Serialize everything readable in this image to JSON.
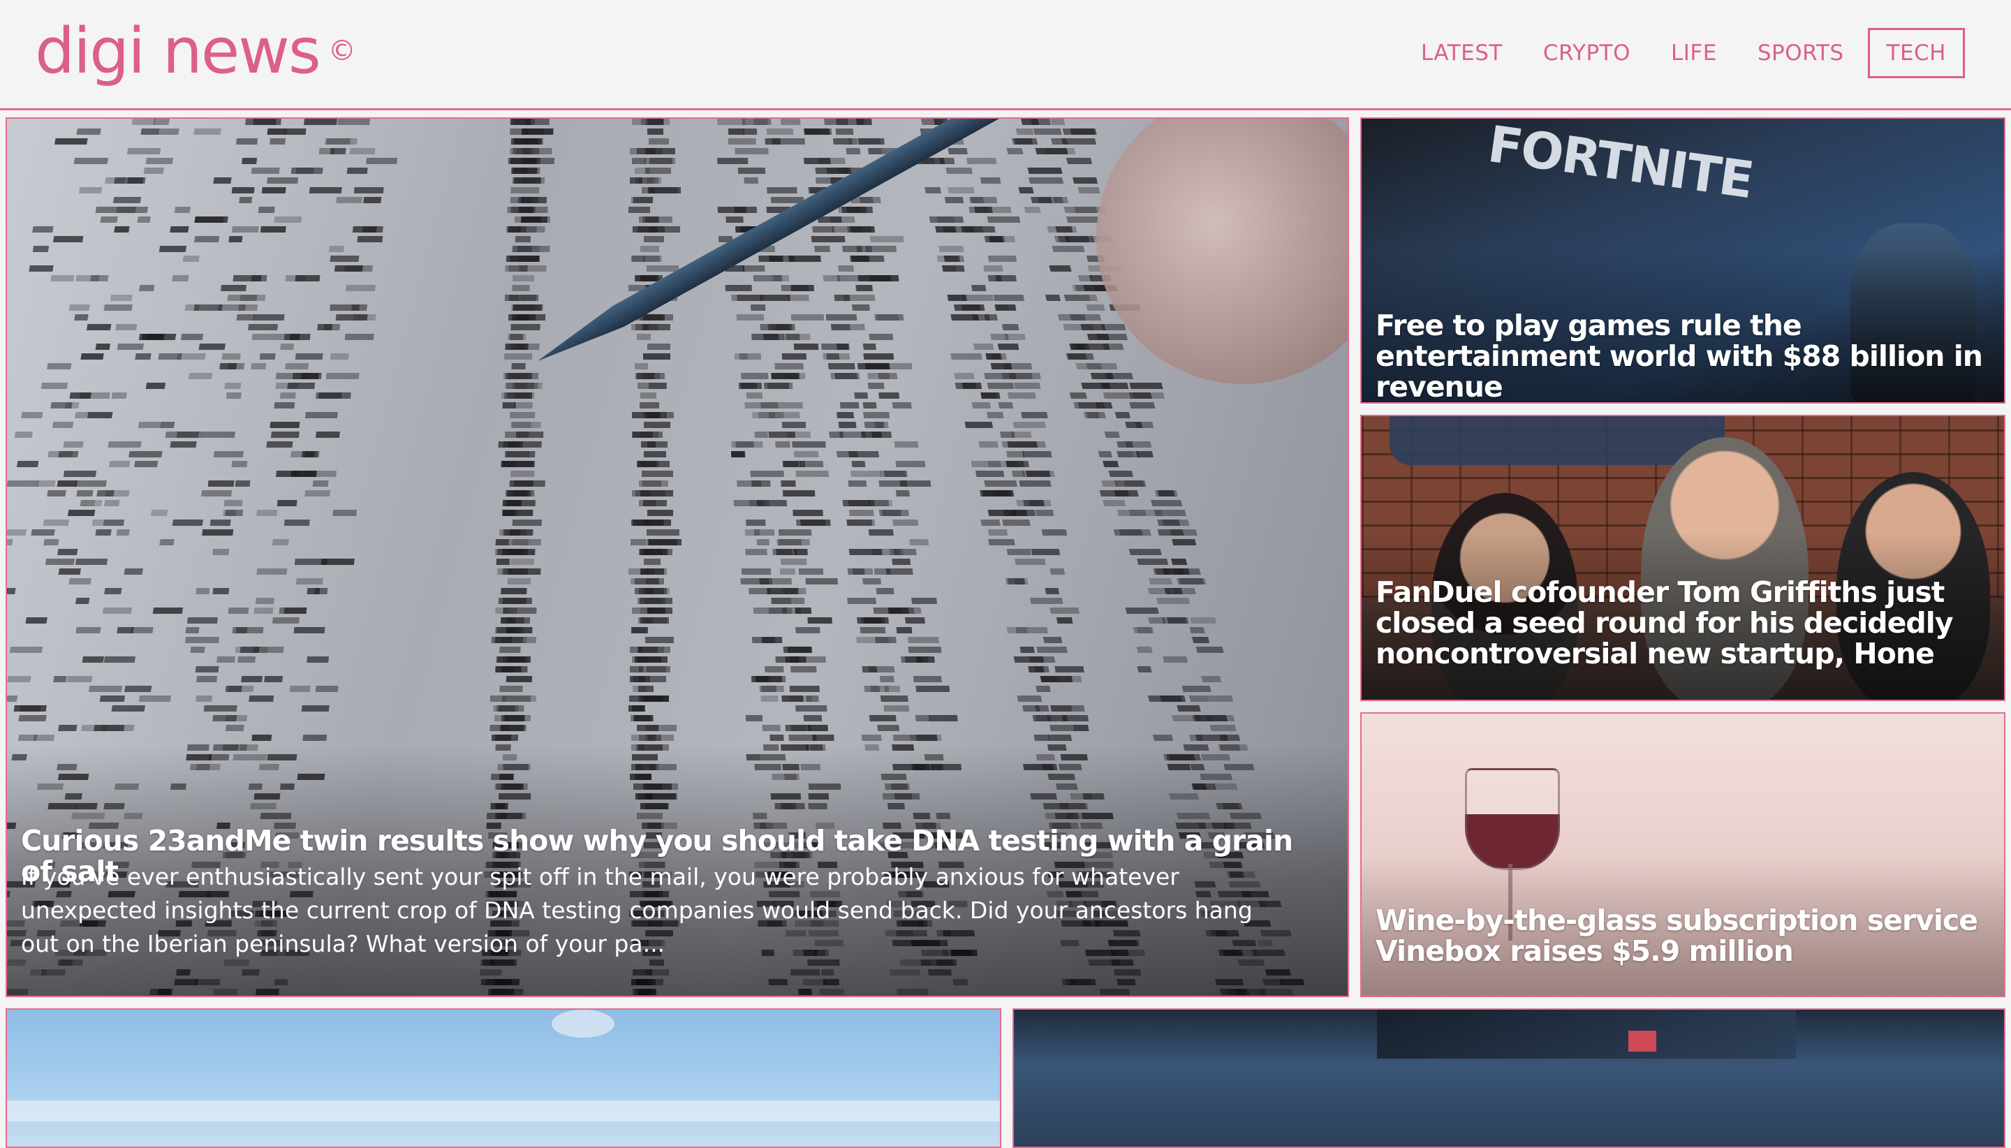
{
  "brand": {
    "name": "digi news",
    "mark": "©"
  },
  "nav": {
    "items": [
      {
        "label": "LATEST"
      },
      {
        "label": "CRYPTO"
      },
      {
        "label": "LIFE"
      },
      {
        "label": "SPORTS"
      },
      {
        "label": "TECH",
        "active": true
      }
    ]
  },
  "featured": {
    "title": "Curious 23andMe twin results show why you should take DNA testing with a grain of salt",
    "excerpt": "If you've ever enthusiastically sent your spit off in the mail, you were probably anxious for whatever unexpected insights the current crop of DNA testing companies would send back. Did your ancestors hang out on the Iberian peninsula? What version of your pa..."
  },
  "side_articles": [
    {
      "title": "Free to play games rule the entertainment world with $88 billion in revenue",
      "image_text": "FORTNITE"
    },
    {
      "title": "FanDuel cofounder Tom Griffiths just closed a seed round for his decidedly noncontroversial new startup, Hone"
    },
    {
      "title": "Wine-by-the-glass subscription service Vinebox raises $5.9 million"
    }
  ],
  "colors": {
    "accent": "#dc5f8a",
    "background": "#f4f4f4",
    "card_border": "#e26c93"
  }
}
